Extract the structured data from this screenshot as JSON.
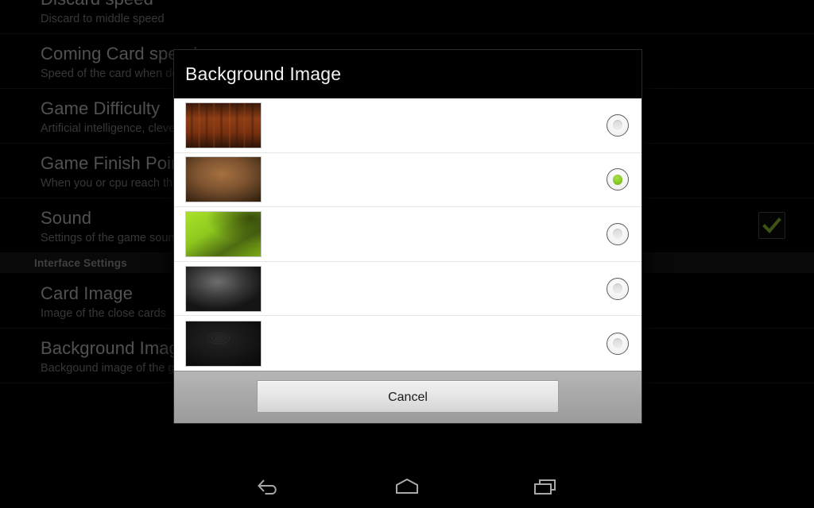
{
  "screen": {
    "platform_bar_color": "#000000",
    "accent_color": "#8ccd2b"
  },
  "settings": {
    "rows": [
      {
        "title": "Discard speed",
        "summary": "Discard to middle speed",
        "has_checkbox": false,
        "checked": false
      },
      {
        "title": "Coming Card speed",
        "summary": "Speed of the card when dealing",
        "has_checkbox": false,
        "checked": false
      },
      {
        "title": "Game Difficulty",
        "summary": "Artificial intelligence, clever",
        "has_checkbox": false,
        "checked": false
      },
      {
        "title": "Game Finish Point",
        "summary": "When you or cpu reach this",
        "has_checkbox": false,
        "checked": false
      },
      {
        "title": "Sound",
        "summary": "Settings of the game sounds",
        "has_checkbox": true,
        "checked": true
      }
    ],
    "section_header": "Interface Settings",
    "rows_after": [
      {
        "title": "Card Image",
        "summary": "Image of the close cards",
        "has_checkbox": false,
        "checked": false
      },
      {
        "title": "Background Image",
        "summary": "Backgound image of the game",
        "has_checkbox": false,
        "checked": false
      }
    ]
  },
  "dialog": {
    "title": "Background Image",
    "selected_index": 1,
    "items": [
      {
        "label": "",
        "thumb": "wood-dark-red",
        "selected": false
      },
      {
        "label": "",
        "thumb": "brown-gradient",
        "selected": true
      },
      {
        "label": "",
        "thumb": "green-gradient",
        "selected": false
      },
      {
        "label": "",
        "thumb": "gray-spotlight",
        "selected": false
      },
      {
        "label": "",
        "thumb": "black-pattern",
        "selected": false
      }
    ],
    "cancel_label": "Cancel"
  },
  "navbar": {
    "back_label": "Back",
    "home_label": "Home",
    "recents_label": "Recent apps"
  }
}
